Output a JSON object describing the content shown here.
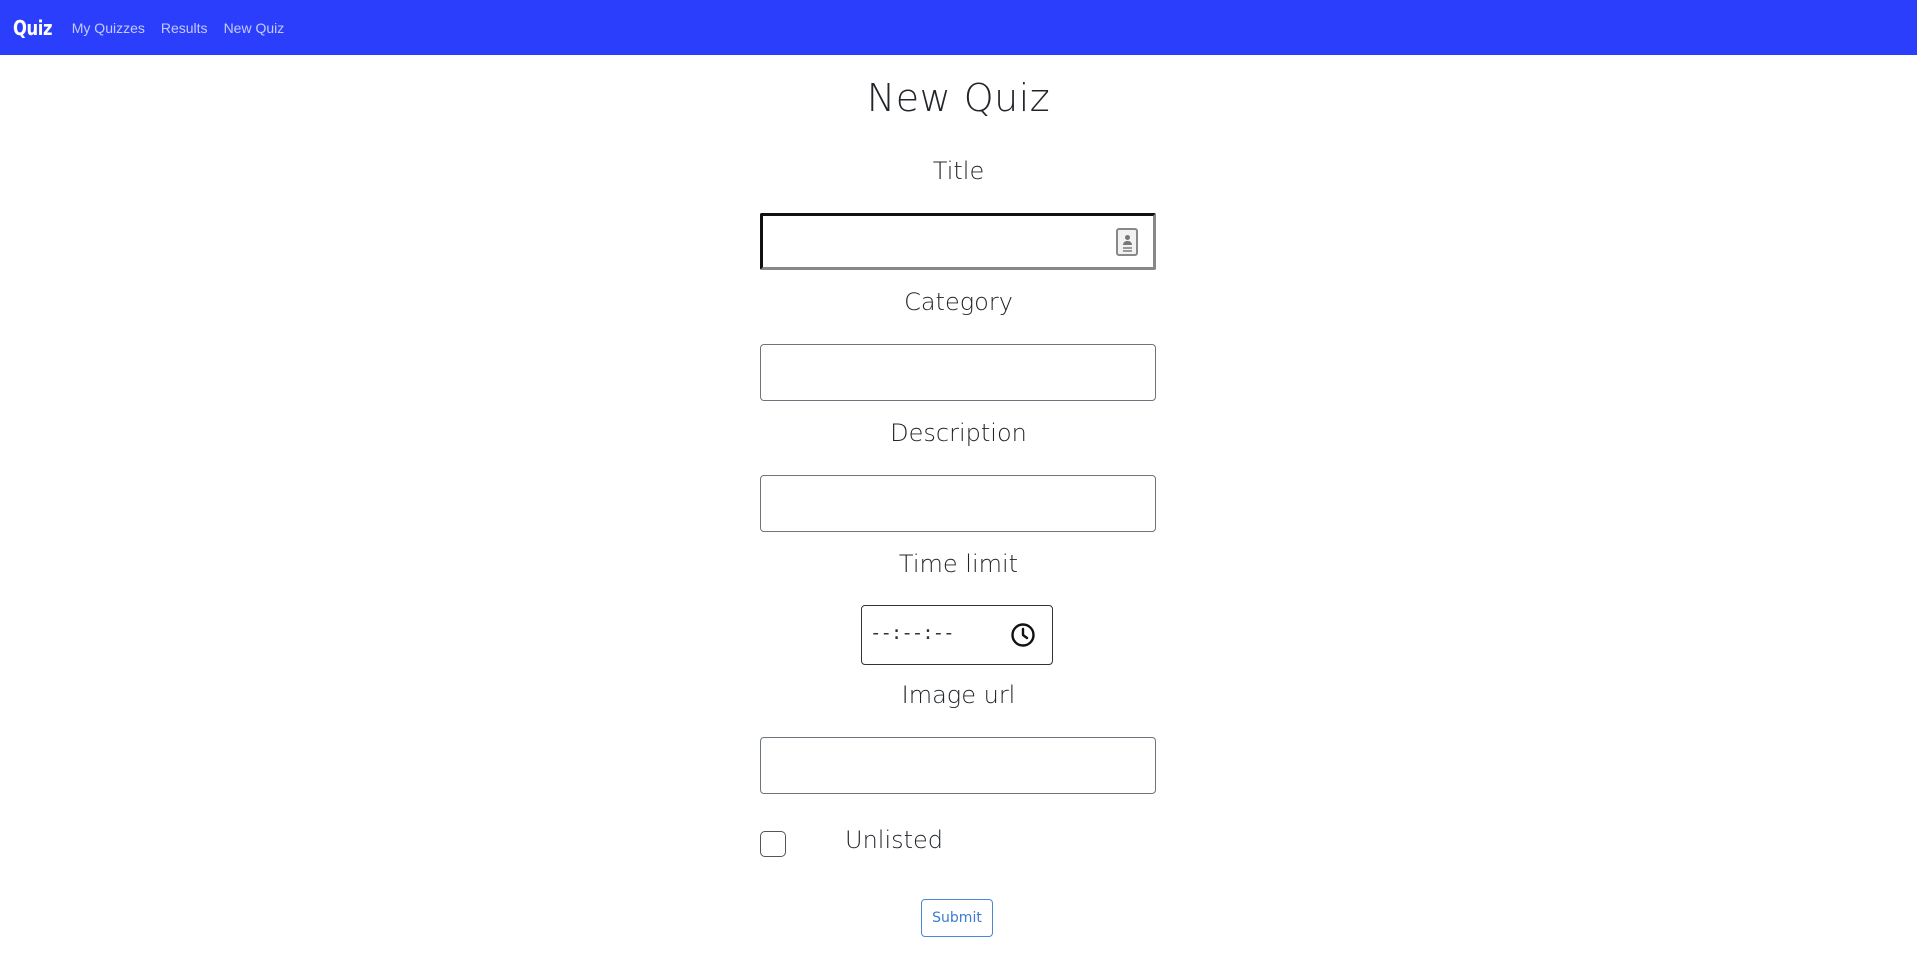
{
  "navbar": {
    "brand": "Quiz",
    "links": [
      {
        "label": "My Quizzes"
      },
      {
        "label": "Results"
      },
      {
        "label": "New Quiz"
      }
    ],
    "background_color": "#2b3efc"
  },
  "page": {
    "title": "New Quiz"
  },
  "form": {
    "title_label": "Title",
    "title_value": "",
    "category_label": "Category",
    "category_value": "",
    "description_label": "Description",
    "description_value": "",
    "time_limit_label": "Time limit",
    "time_limit_placeholder": "--:--:--",
    "image_url_label": "Image url",
    "image_url_value": "",
    "unlisted_label": "Unlisted",
    "unlisted_checked": false,
    "submit_label": "Submit",
    "accent_color": "#3d7ad3"
  },
  "icons": {
    "autofill": "contact-autofill-icon",
    "clock": "clock-icon"
  }
}
